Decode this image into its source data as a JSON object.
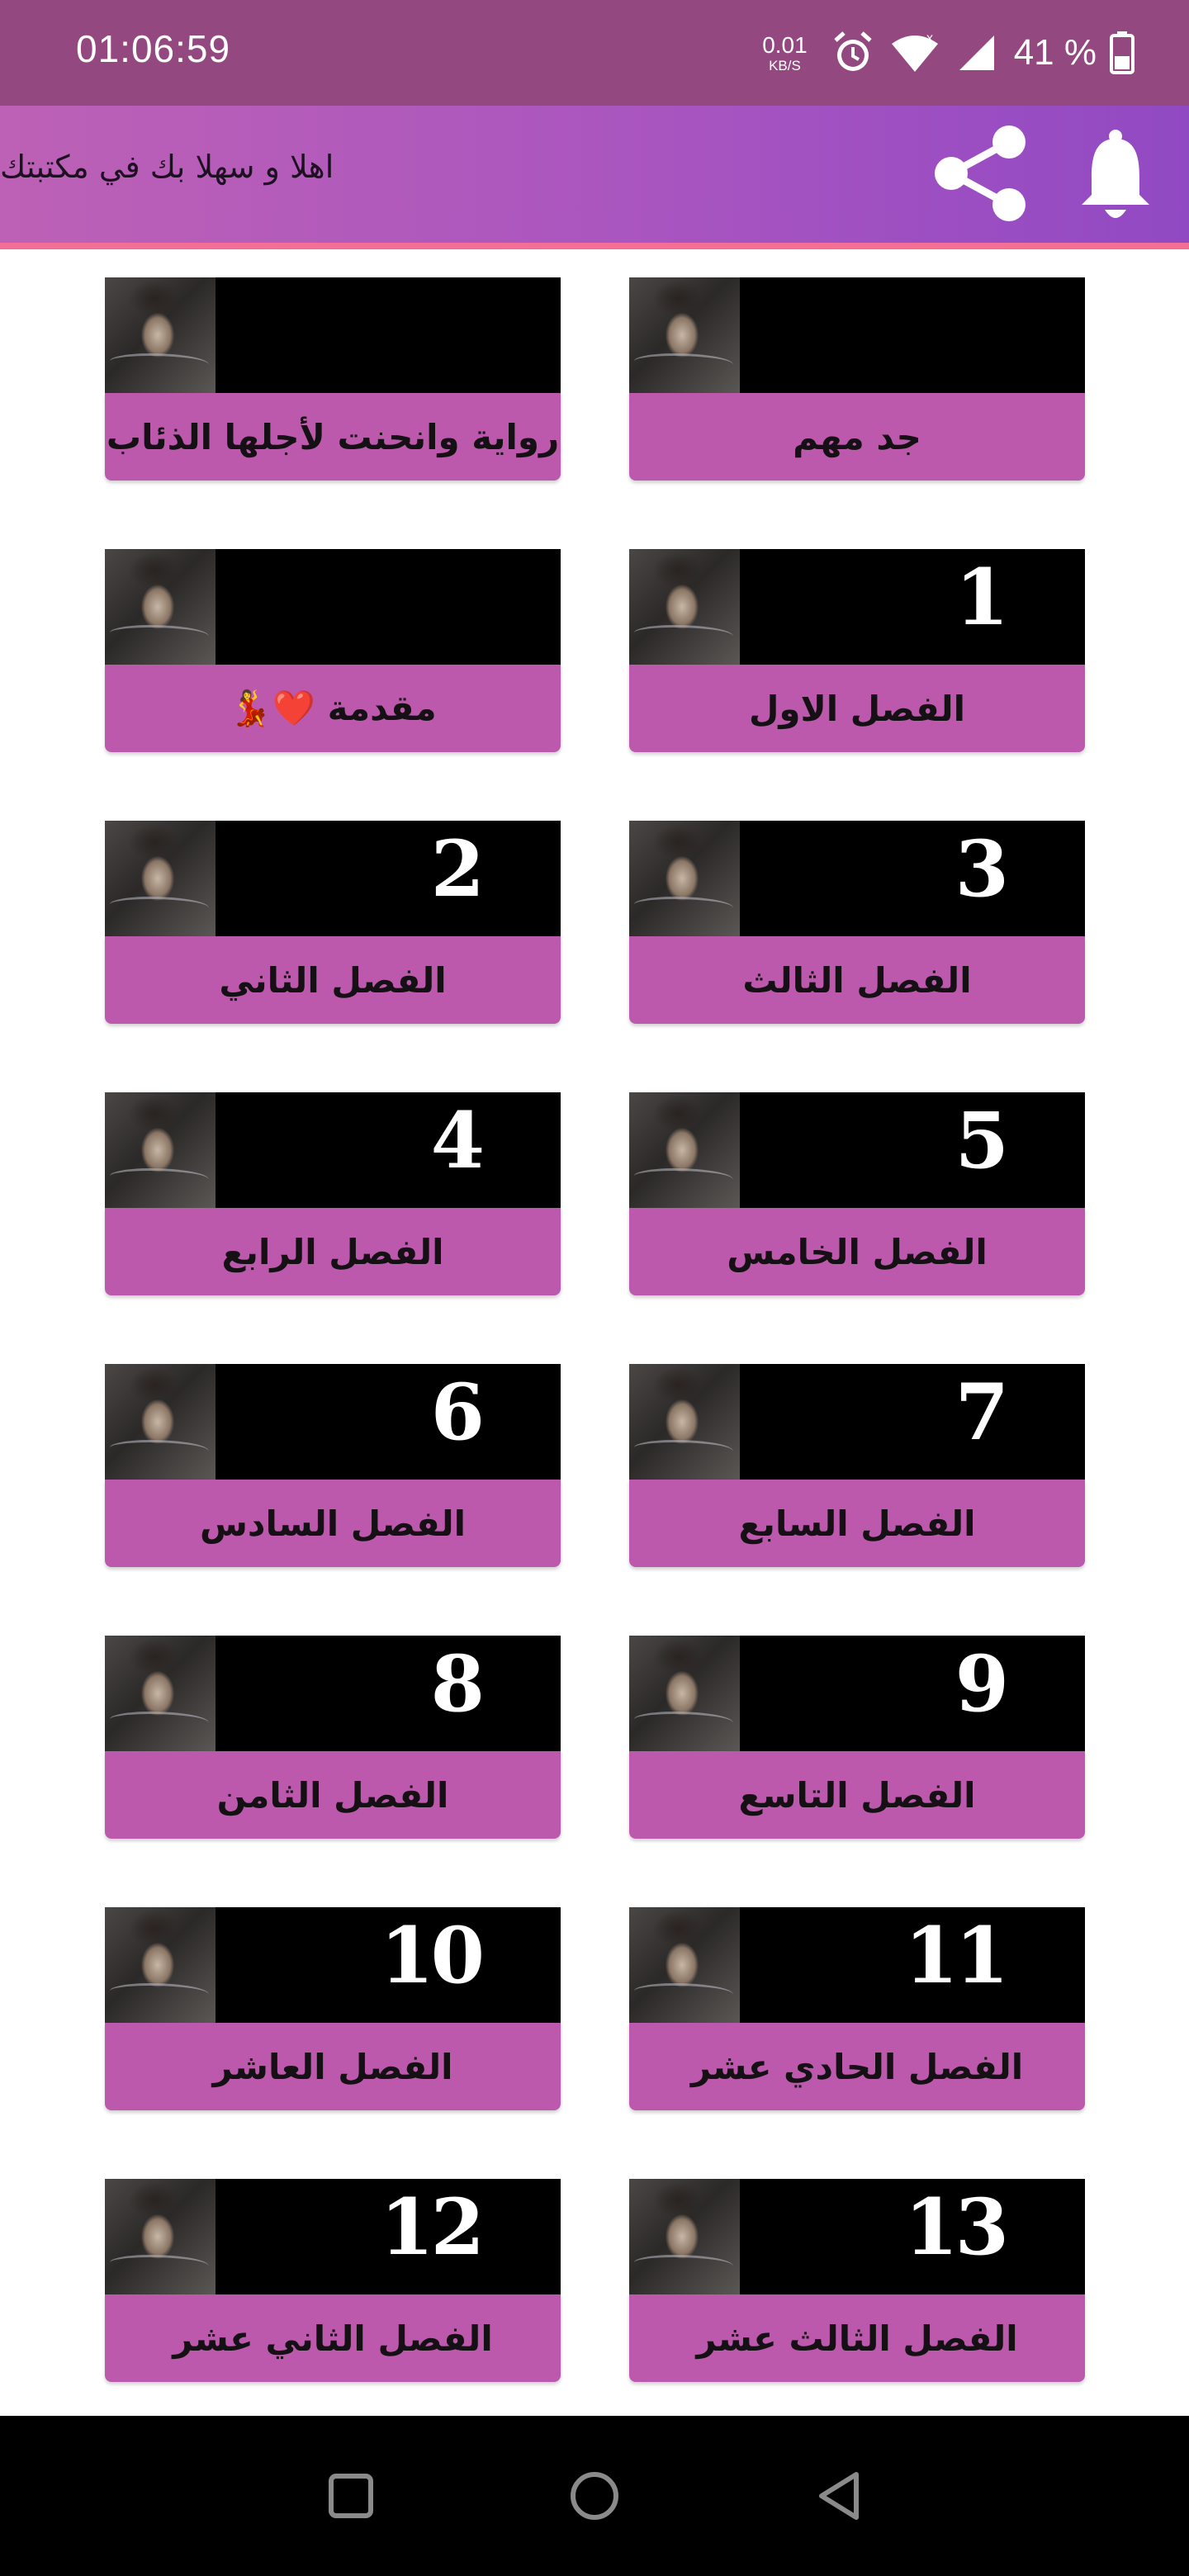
{
  "status_bar": {
    "time": "01:06:59",
    "net_speed_value": "0.01",
    "net_speed_unit": "KB/S",
    "battery": "41 %",
    "icons": [
      "alarm-icon",
      "wifi-icon",
      "signal-icon",
      "battery-icon"
    ]
  },
  "app_bar": {
    "title": "اهلا و سهلا بك في مكتبتك",
    "share_icon": "share-icon",
    "bell_icon": "bell-icon",
    "colors": {
      "start": "#bd61b6",
      "end": "#9149c3",
      "underline": "#f46f96"
    }
  },
  "cards": [
    {
      "label": "جد مهم",
      "number": ""
    },
    {
      "label": "رواية وانحنت لأجلها الذئاب",
      "number": ""
    },
    {
      "label": "الفصل الاول",
      "number": "1"
    },
    {
      "label": "مقدمة ❤️💃",
      "number": ""
    },
    {
      "label": "الفصل الثالث",
      "number": "3"
    },
    {
      "label": "الفصل الثاني",
      "number": "2"
    },
    {
      "label": "الفصل الخامس",
      "number": "5"
    },
    {
      "label": "الفصل الرابع",
      "number": "4"
    },
    {
      "label": "الفصل السابع",
      "number": "7"
    },
    {
      "label": "الفصل السادس",
      "number": "6"
    },
    {
      "label": "الفصل التاسع",
      "number": "9"
    },
    {
      "label": "الفصل الثامن",
      "number": "8"
    },
    {
      "label": "الفصل الحادي عشر",
      "number": "11"
    },
    {
      "label": "الفصل العاشر",
      "number": "10"
    },
    {
      "label": "الفصل الثالث عشر",
      "number": "13"
    },
    {
      "label": "الفصل الثاني عشر",
      "number": "12"
    }
  ],
  "card_colors": {
    "label_bg": "#bd59ad",
    "image_bg": "#000000"
  },
  "nav_bar": {
    "icons": [
      "square-recents-icon",
      "circle-home-icon",
      "triangle-back-icon"
    ]
  }
}
